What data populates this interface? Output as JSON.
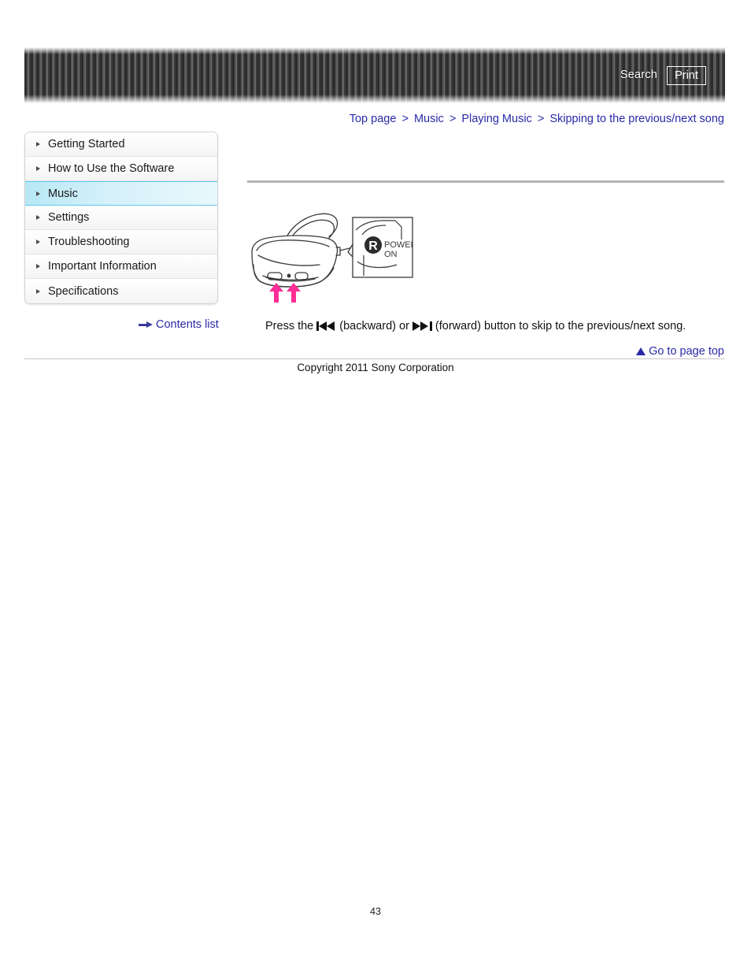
{
  "header": {
    "search_label": "Search",
    "print_label": "Print"
  },
  "breadcrumb": {
    "separator": ">",
    "items": [
      {
        "label": "Top page"
      },
      {
        "label": "Music"
      },
      {
        "label": "Playing Music"
      },
      {
        "label": "Skipping to the previous/next song"
      }
    ]
  },
  "sidebar": {
    "items": [
      {
        "label": "Getting Started",
        "active": false
      },
      {
        "label": "How to Use the Software",
        "active": false
      },
      {
        "label": "Music",
        "active": true
      },
      {
        "label": "Settings",
        "active": false
      },
      {
        "label": "Troubleshooting",
        "active": false
      },
      {
        "label": "Important Information",
        "active": false
      },
      {
        "label": "Specifications",
        "active": false
      }
    ],
    "contents_list_label": "Contents list"
  },
  "main": {
    "figure": {
      "callout_badge": "R",
      "callout_line1": "POWER",
      "callout_line2": "ON",
      "arrow_color": "#ff2d96",
      "line_color": "#3a3a3a"
    },
    "instruction": {
      "part1": "Press the",
      "backward_label": "(backward)",
      "or_label": "or",
      "forward_label": "(forward)",
      "part2": "button to skip to the previous/next song."
    }
  },
  "footer": {
    "go_to_top_label": "Go to page top",
    "copyright": "Copyright 2011 Sony Corporation",
    "page_number": "43"
  },
  "colors": {
    "link": "#2a2aa8",
    "active_nav": "#b8e8f5",
    "rule": "#b4b4b4"
  }
}
